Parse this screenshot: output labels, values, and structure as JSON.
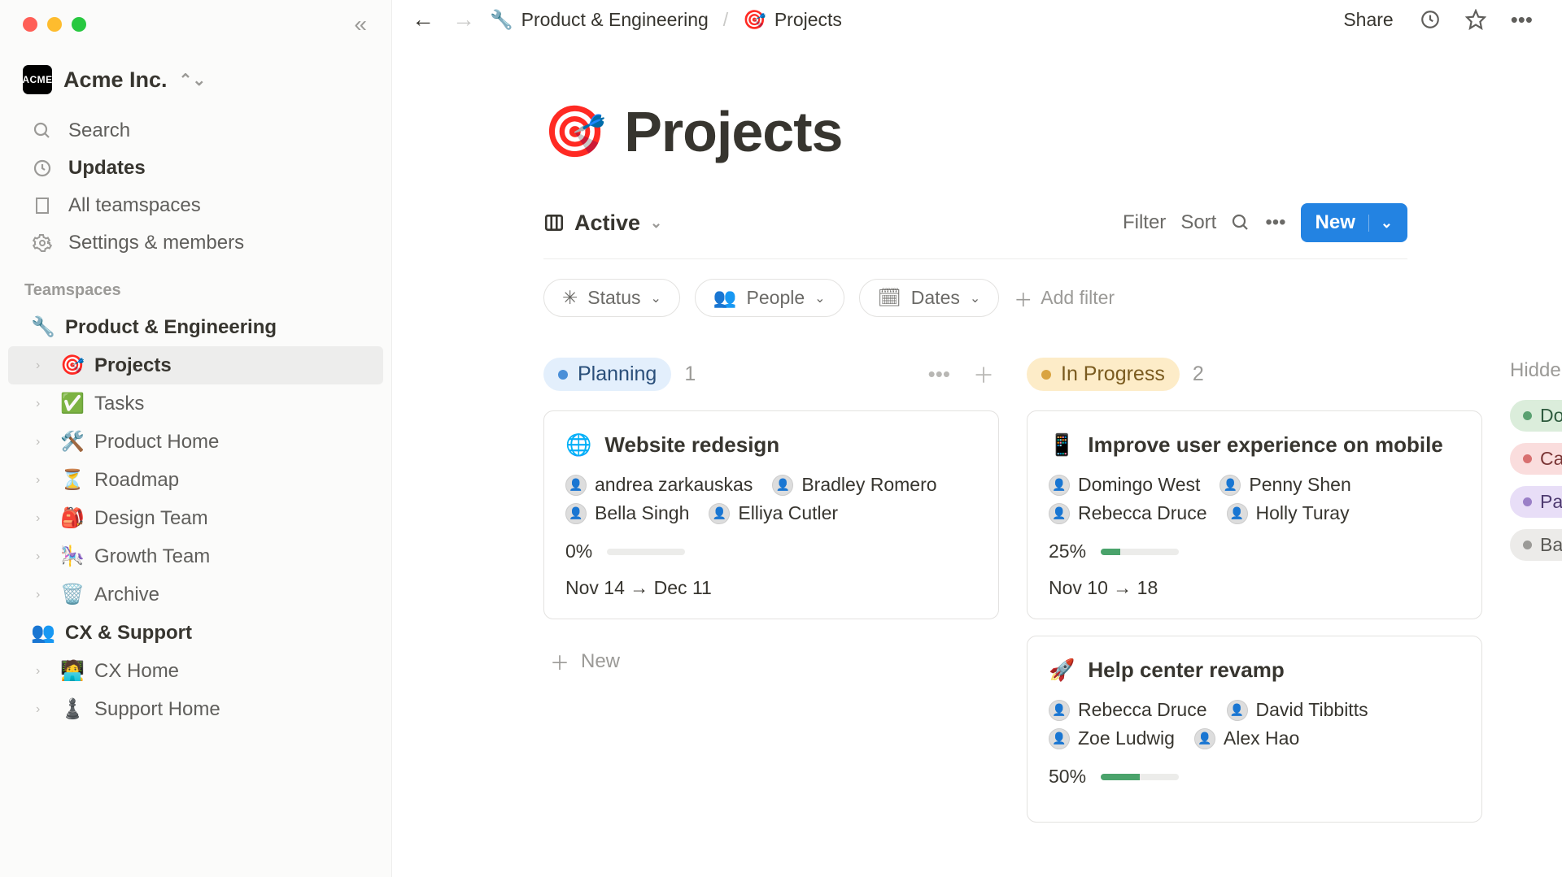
{
  "workspace": {
    "name": "Acme Inc.",
    "badge": "ACME"
  },
  "sidebar": {
    "search": "Search",
    "updates": "Updates",
    "teamspaces_link": "All teamspaces",
    "settings": "Settings & members",
    "teamspaces_header": "Teamspaces",
    "teamspaces": [
      {
        "emoji": "🔧",
        "label": "Product & Engineering",
        "children": [
          {
            "emoji": "🎯",
            "label": "Projects",
            "active": true
          },
          {
            "emoji": "✅",
            "label": "Tasks"
          },
          {
            "emoji": "🛠️",
            "label": "Product Home"
          },
          {
            "emoji": "⏳",
            "label": "Roadmap"
          },
          {
            "emoji": "🎒",
            "label": "Design Team"
          },
          {
            "emoji": "🎠",
            "label": "Growth Team"
          },
          {
            "emoji": "🗑️",
            "label": "Archive"
          }
        ]
      },
      {
        "emoji": "👥",
        "label": "CX & Support",
        "children": [
          {
            "emoji": "🧑‍💻",
            "label": "CX Home"
          },
          {
            "emoji": "♟️",
            "label": "Support Home"
          }
        ]
      }
    ]
  },
  "breadcrumb": {
    "parent_emoji": "🔧",
    "parent": "Product & Engineering",
    "current_emoji": "🎯",
    "current": "Projects"
  },
  "topbar": {
    "share": "Share"
  },
  "page": {
    "emoji": "🎯",
    "title": "Projects"
  },
  "view": {
    "name": "Active",
    "filter": "Filter",
    "sort": "Sort",
    "new": "New"
  },
  "filters": {
    "status": "Status",
    "people": "People",
    "dates": "Dates",
    "add": "Add filter"
  },
  "board": {
    "columns": [
      {
        "id": "planning",
        "label": "Planning",
        "count": "1",
        "pillClass": "pill-planning",
        "cards": [
          {
            "emoji": "🌐",
            "title": "Website redesign",
            "people": [
              "andrea zarkauskas",
              "Bradley Romero",
              "Bella Singh",
              "Elliya Cutler"
            ],
            "progress": "0%",
            "progress_pct": 0,
            "dates": "Nov 14 → Dec 11"
          }
        ]
      },
      {
        "id": "inprogress",
        "label": "In Progress",
        "count": "2",
        "pillClass": "pill-progress",
        "cards": [
          {
            "emoji": "📱",
            "title": "Improve user experience on mobile",
            "people": [
              "Domingo West",
              "Penny Shen",
              "Rebecca Druce",
              "Holly Turay"
            ],
            "progress": "25%",
            "progress_pct": 25,
            "dates": "Nov 10 → 18"
          },
          {
            "emoji": "🚀",
            "title": "Help center revamp",
            "people": [
              "Rebecca Druce",
              "David Tibbitts",
              "Zoe Ludwig",
              "Alex Hao"
            ],
            "progress": "50%",
            "progress_pct": 50,
            "dates": ""
          }
        ]
      }
    ],
    "new_card": "New",
    "hidden_label": "Hidden",
    "hidden": [
      {
        "label": "Done",
        "cls": "hp-done"
      },
      {
        "label": "Cancelled",
        "cls": "hp-can"
      },
      {
        "label": "Paused",
        "cls": "hp-pause"
      },
      {
        "label": "Backlog",
        "cls": "hp-back"
      }
    ]
  }
}
